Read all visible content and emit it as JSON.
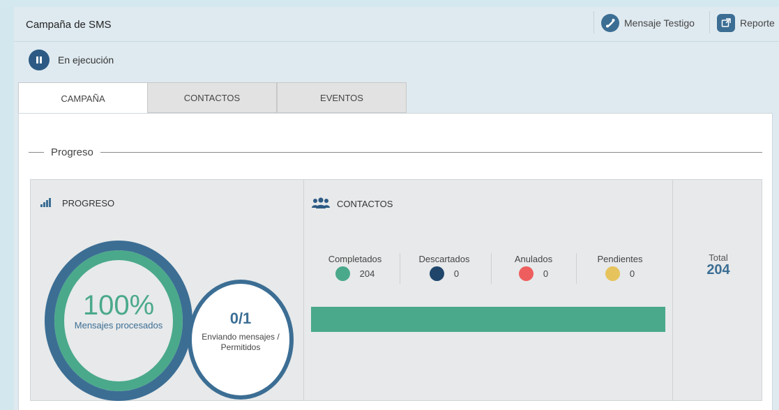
{
  "header": {
    "title": "Campaña de SMS",
    "actions": [
      {
        "label": "Mensaje Testigo",
        "icon": "phone-icon"
      },
      {
        "label": "Reporte",
        "icon": "external-link-icon"
      }
    ]
  },
  "status": {
    "text": "En ejecución",
    "icon": "pause-icon"
  },
  "tabs": [
    {
      "label": "CAMPAÑA",
      "active": true
    },
    {
      "label": "CONTACTOS",
      "active": false
    },
    {
      "label": "EVENTOS",
      "active": false
    }
  ],
  "section": {
    "title": "Progreso"
  },
  "progress_panel": {
    "title": "PROGRESO",
    "icon": "signal-bars-icon",
    "percent_text": "100%",
    "percent_label": "Mensajes procesados",
    "percent_value": 100,
    "ratio_text": "0/1",
    "ratio_label_line1": "Enviando mensajes /",
    "ratio_label_line2": "Permitidos"
  },
  "contacts_panel": {
    "title": "CONTACTOS",
    "icon": "users-icon",
    "stats": [
      {
        "label": "Completados",
        "value": "204",
        "color": "#4aa98a"
      },
      {
        "label": "Descartados",
        "value": "0",
        "color": "#1f456b"
      },
      {
        "label": "Anulados",
        "value": "0",
        "color": "#ee5e5e"
      },
      {
        "label": "Pendientes",
        "value": "0",
        "color": "#e6c35c"
      }
    ],
    "completed_fraction": 1.0
  },
  "total": {
    "label": "Total",
    "value": "204"
  },
  "colors": {
    "accent_blue": "#3c6e94",
    "accent_green": "#4aa98a",
    "header_bg": "#dfeaf0"
  }
}
